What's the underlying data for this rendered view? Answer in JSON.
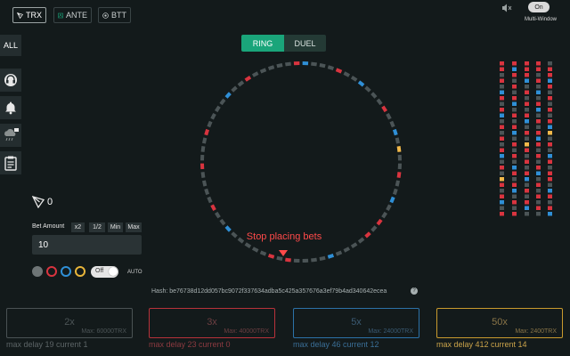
{
  "currencies": [
    {
      "label": "TRX",
      "active": true
    },
    {
      "label": "ANTE",
      "active": false
    },
    {
      "label": "BTT",
      "active": false
    }
  ],
  "controls": {
    "toggle_label": "On",
    "multi_window_label": "Multi-Window"
  },
  "modes": {
    "ring": "RING",
    "duel": "DUEL"
  },
  "sidebar": {
    "all_label": "ALL"
  },
  "balance": {
    "value": "0"
  },
  "bet": {
    "label": "Bet Amount",
    "buttons": [
      "x2",
      "1/2",
      "Min",
      "Max"
    ],
    "value": "10"
  },
  "auto": {
    "switch_label": "Off",
    "label": "AUTO"
  },
  "status_text": "Stop placing bets",
  "hash": {
    "label": "Hash: be76738d12dd057bc9072f337634adba5c425a357676a3ef79b4ad340642ecea"
  },
  "bet_options": [
    {
      "multiplier": "2x",
      "max": "Max: 60000TRX",
      "delay": "max delay 19 current 1",
      "color": "#5c6466"
    },
    {
      "multiplier": "3x",
      "max": "Max: 40000TRX",
      "delay": "max delay 23 current 0",
      "color": "#d9343f"
    },
    {
      "multiplier": "5x",
      "max": "Max: 24000TRX",
      "delay": "max delay 46 current 12",
      "color": "#2f8fd6"
    },
    {
      "multiplier": "50x",
      "max": "Max: 2400TRX",
      "delay": "max delay 412 current 14",
      "color": "#e8b53a"
    }
  ],
  "colors": {
    "gray": "#4b5456",
    "red": "#d9343f",
    "blue": "#2f8fd6",
    "gold": "#f2b94a",
    "accent_green": "#1aa57a",
    "status_red": "#ff4a4a"
  },
  "ring_segments": [
    "blue",
    "gray",
    "gray",
    "gray",
    "red",
    "gray",
    "gray",
    "blue",
    "gray",
    "gray",
    "gray",
    "red",
    "gray",
    "gray",
    "blue",
    "gray",
    "gold",
    "gray",
    "gray",
    "red",
    "gray",
    "gray",
    "blue",
    "gray",
    "gray",
    "red",
    "gray",
    "red",
    "gray",
    "gray",
    "gray",
    "gray",
    "blue",
    "gray",
    "gray",
    "gray",
    "gray",
    "red",
    "gray",
    "red",
    "gray",
    "gray",
    "gray",
    "gray",
    "gray",
    "blue",
    "gray",
    "gray",
    "red",
    "gray",
    "gray",
    "gray",
    "gray",
    "red",
    "gray",
    "gray",
    "gray",
    "red",
    "gray",
    "gray",
    "gray",
    "gray",
    "blue",
    "gray",
    "gray",
    "red",
    "gray",
    "gray",
    "gray",
    "gray",
    "gray",
    "red"
  ],
  "history": [
    [
      "red",
      "red",
      "red",
      "red",
      "gray"
    ],
    [
      "red",
      "blue",
      "red",
      "red",
      "red"
    ],
    [
      "gray",
      "red",
      "red",
      "gray",
      "red"
    ],
    [
      "red",
      "gray",
      "blue",
      "red",
      "blue"
    ],
    [
      "gray",
      "red",
      "gray",
      "gray",
      "red"
    ],
    [
      "blue",
      "gray",
      "red",
      "blue",
      "gray"
    ],
    [
      "red",
      "red",
      "gray",
      "gray",
      "red"
    ],
    [
      "gray",
      "blue",
      "red",
      "red",
      "gray"
    ],
    [
      "red",
      "gray",
      "gray",
      "blue",
      "red"
    ],
    [
      "blue",
      "red",
      "red",
      "gray",
      "gray"
    ],
    [
      "gray",
      "gray",
      "blue",
      "red",
      "red"
    ],
    [
      "red",
      "red",
      "gray",
      "gray",
      "blue"
    ],
    [
      "gray",
      "blue",
      "red",
      "red",
      "gold"
    ],
    [
      "red",
      "gray",
      "gray",
      "blue",
      "gray"
    ],
    [
      "gray",
      "red",
      "gold",
      "red",
      "red"
    ],
    [
      "red",
      "gray",
      "red",
      "gray",
      "gray"
    ],
    [
      "blue",
      "red",
      "gray",
      "red",
      "blue"
    ],
    [
      "gray",
      "gray",
      "red",
      "gray",
      "red"
    ],
    [
      "red",
      "blue",
      "gray",
      "red",
      "gray"
    ],
    [
      "gray",
      "red",
      "red",
      "blue",
      "red"
    ],
    [
      "gold",
      "gray",
      "blue",
      "gray",
      "red"
    ],
    [
      "red",
      "red",
      "gray",
      "red",
      "gray"
    ],
    [
      "gray",
      "blue",
      "red",
      "gray",
      "blue"
    ],
    [
      "red",
      "gray",
      "gray",
      "red",
      "red"
    ],
    [
      "blue",
      "red",
      "red",
      "gray",
      "gray"
    ],
    [
      "gray",
      "gray",
      "blue",
      "red",
      "red"
    ],
    [
      "red",
      "red",
      "gray",
      "gray",
      "blue"
    ]
  ]
}
